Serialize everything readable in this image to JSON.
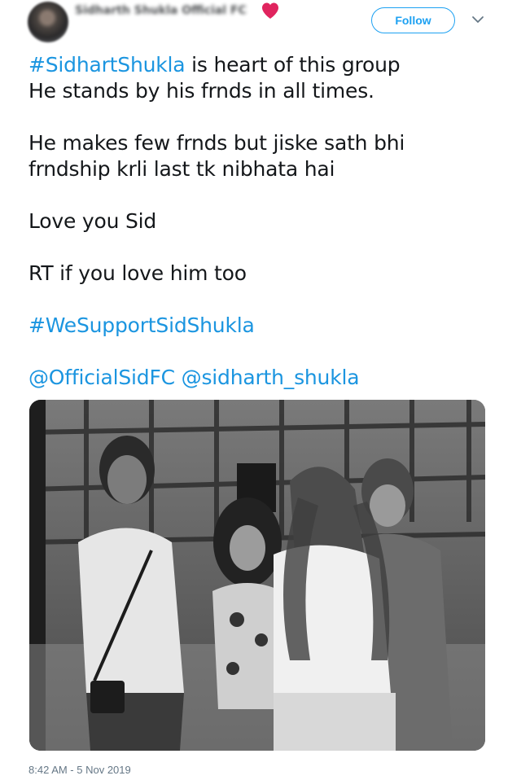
{
  "header": {
    "display_name": "Sidharth Shukla Official FC",
    "follow_label": "Follow"
  },
  "tweet": {
    "line1_hashtag": "#SidhartShukla",
    "line1_rest": " is heart of this group",
    "line2": "He stands by his frnds in all times.",
    "line3": "He makes few frnds but jiske sath bhi",
    "line4": "frndship krli last tk nibhata hai",
    "line5": "Love you Sid",
    "line6": "RT if you love him too",
    "hashtag2": "#WeSupportSidShukla",
    "mention1": "@OfficialSidFC",
    "mention2": "@sidharth_shukla"
  },
  "timestamp": "8:42 AM - 5 Nov 2019",
  "colors": {
    "link": "#1b95e0",
    "follow": "#1da1f2",
    "heart": "#e0245e",
    "muted": "#657786"
  },
  "icons": [
    "heart-icon",
    "chevron-down-icon"
  ]
}
